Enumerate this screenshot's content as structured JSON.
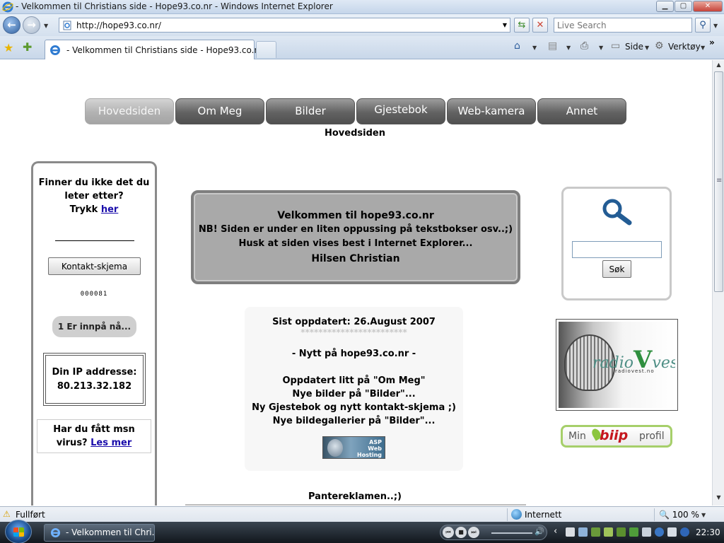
{
  "window": {
    "title": "- Velkommen til Christians side - Hope93.co.nr - Windows Internet Explorer",
    "min_icon": "minimize-icon",
    "max_icon": "maximize-icon",
    "close_icon": "close-icon"
  },
  "addressbar": {
    "url": "http://hope93.co.nr/",
    "search_placeholder": "Live Search"
  },
  "tabs": [
    {
      "label": "- Velkommen til Christians side - Hope93.co.nr"
    }
  ],
  "commandbar": {
    "page_label": "Side",
    "tools_label": "Verktøy"
  },
  "site": {
    "nav": [
      {
        "label": "Hovedsiden",
        "active": true
      },
      {
        "label": "Om Meg",
        "active": false
      },
      {
        "label": "Bilder",
        "active": false
      },
      {
        "label": "Gjestebok",
        "active": false
      },
      {
        "label": "Web-kamera",
        "active": false
      },
      {
        "label": "Annet",
        "active": false
      }
    ],
    "subtitle": "Hovedsiden",
    "left": {
      "question_line1": "Finner du ikke det du",
      "question_line2": "leter etter?",
      "question_line3": "Trykk ",
      "question_link": "her",
      "contact_button": "Kontakt-skjema",
      "counter": "000081",
      "online": "1 Er innpå nå...",
      "ip_label": "Din IP addresse:",
      "ip_value": "80.213.32.182",
      "msn_line1": "Har du fått msn",
      "msn_line2": "virus? ",
      "msn_link": "Les mer"
    },
    "welcome": {
      "line1": "Velkommen til hope93.co.nr",
      "line2": "NB! Siden er under en liten oppussing på tekstbokser osv..;)",
      "line3": "Husk at siden vises best i Internet Explorer...",
      "line4": "Hilsen Christian"
    },
    "updates": {
      "last_updated": "Sist oppdatert: 26.August 2007",
      "stars": "************************",
      "news_heading": "- Nytt på hope93.co.nr -",
      "items": [
        "Oppdatert litt på \"Om Meg\"",
        "Nye bilder på \"Bilder\"...",
        "Ny Gjestebok og nytt kontakt-skjema ;)",
        "Nye bildegallerier på \"Bilder\"..."
      ],
      "badge_line1": "ASP",
      "badge_line2": "Web",
      "badge_line3": "Hosting"
    },
    "panter": "Pantereklamen..;)",
    "search_button": "Søk",
    "radio": {
      "brand_pre": "radio",
      "brand_v": "V",
      "brand_post": "vest",
      "site": "radiovest.no"
    },
    "biip": {
      "min": "Min",
      "word": "biip",
      "profil": "profil"
    }
  },
  "statusbar": {
    "status": "Fullført",
    "zone": "Internett",
    "zoom": "100 %"
  },
  "taskbar": {
    "task_label": "- Velkommen til Chri...",
    "clock": "22:30"
  }
}
